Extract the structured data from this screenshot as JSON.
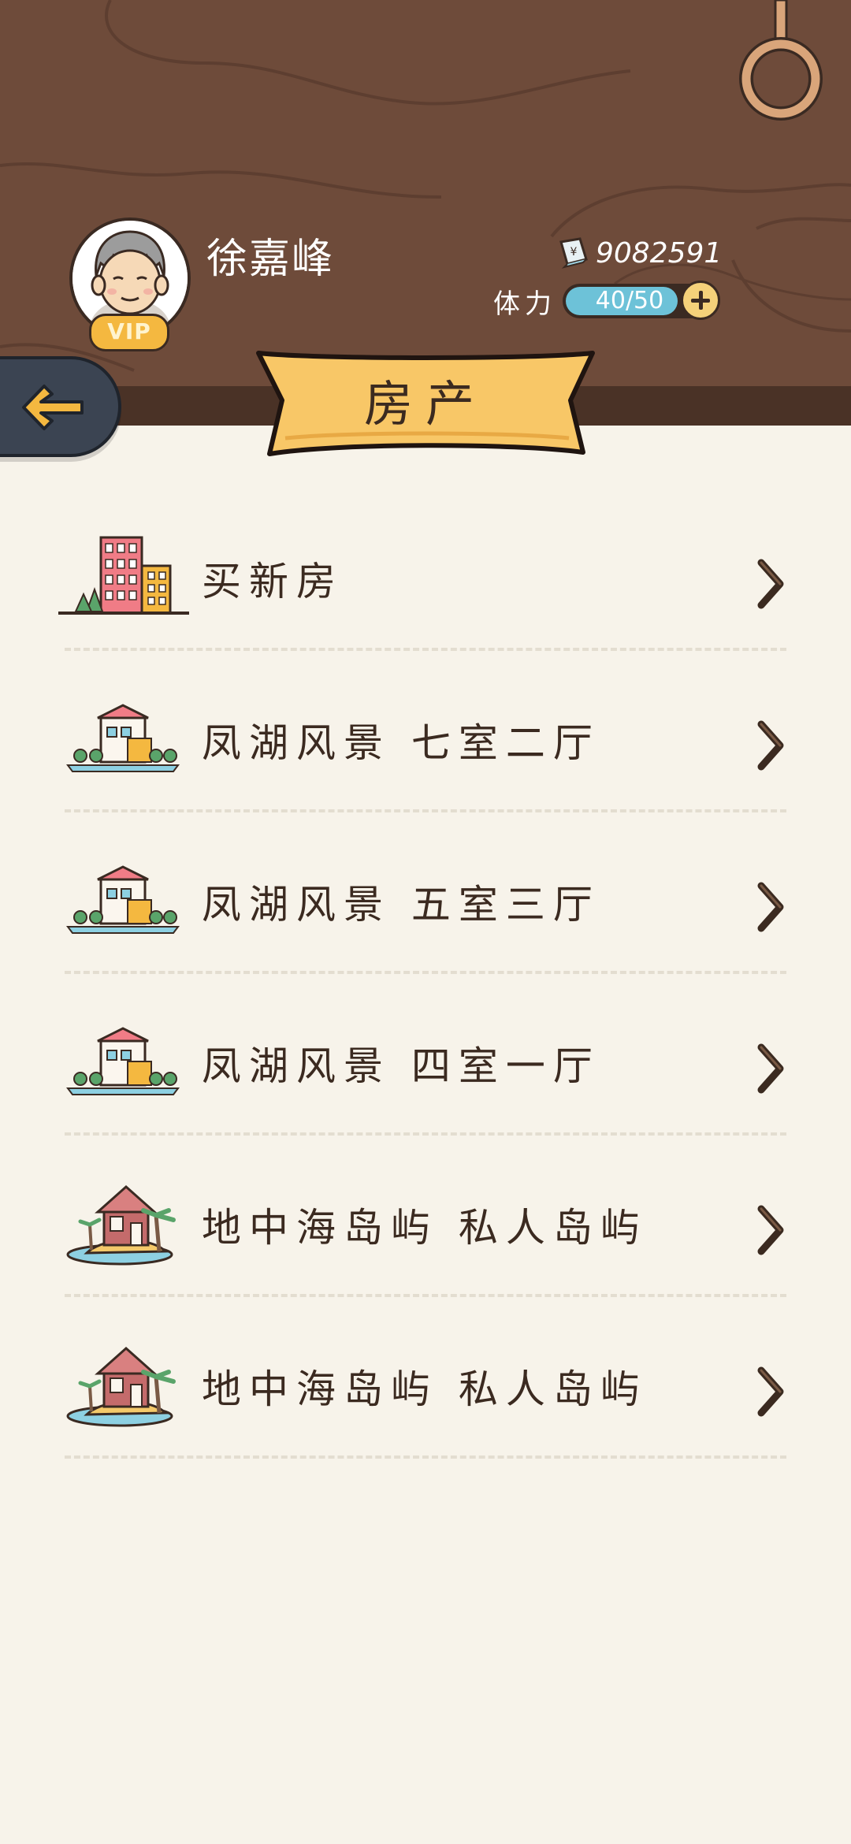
{
  "user": {
    "name": "徐嘉峰",
    "vip_label": "VIP"
  },
  "currency": {
    "icon": "banknote-icon",
    "value": "9082591"
  },
  "stamina": {
    "label": "体力",
    "value": "40/50",
    "current": 40,
    "max": 50
  },
  "page": {
    "title": "房产"
  },
  "colors": {
    "wood": "#6e4b3a",
    "banner": "#f8c767",
    "text": "#3b2a20",
    "stamina_fill": "#6dc2d8"
  },
  "list": [
    {
      "label": "买新房",
      "icon": "city-buildings-icon"
    },
    {
      "label": "凤湖风景  七室二厅",
      "icon": "villa-icon"
    },
    {
      "label": "凤湖风景  五室三厅",
      "icon": "villa-icon"
    },
    {
      "label": "凤湖风景  四室一厅",
      "icon": "villa-icon"
    },
    {
      "label": "地中海岛屿  私人岛屿",
      "icon": "island-house-icon"
    },
    {
      "label": "地中海岛屿  私人岛屿",
      "icon": "island-house-icon"
    }
  ]
}
